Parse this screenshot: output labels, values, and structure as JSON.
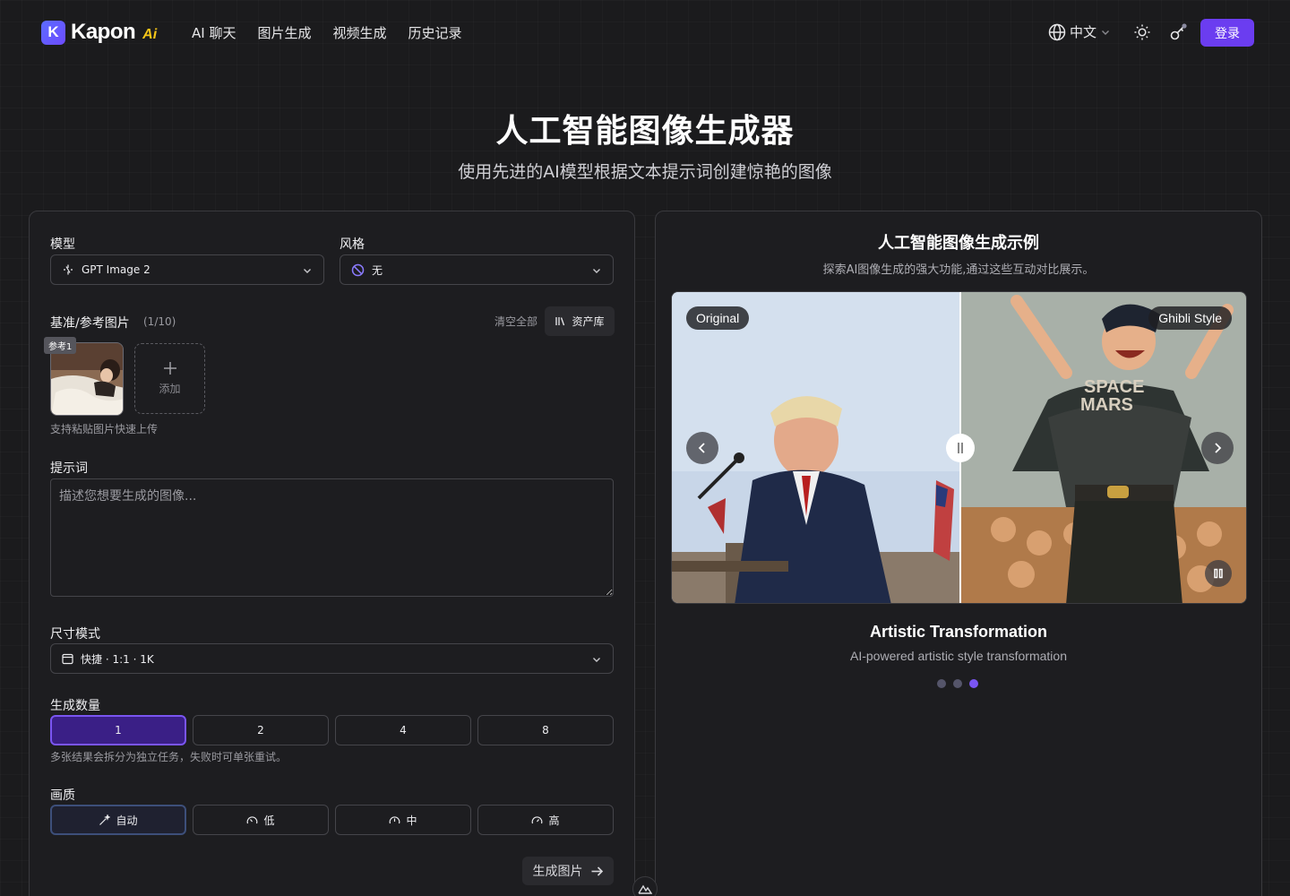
{
  "header": {
    "logo_mark": "K",
    "logo_text": "Kapon",
    "logo_ai": "Ai",
    "nav": [
      "AI 聊天",
      "图片生成",
      "视频生成",
      "历史记录"
    ],
    "language": "中文",
    "login": "登录"
  },
  "hero": {
    "title": "人工智能图像生成器",
    "subtitle": "使用先进的AI模型根据文本提示词创建惊艳的图像"
  },
  "form": {
    "model_label": "模型",
    "model_value": "GPT Image 2",
    "style_label": "风格",
    "style_value": "无",
    "reference_label": "基准/参考图片",
    "reference_count": "(1/10)",
    "clear_all": "清空全部",
    "asset_library": "资产库",
    "thumb_tag": "参考1",
    "add_label": "添加",
    "paste_hint": "支持粘贴图片快速上传",
    "prompt_label": "提示词",
    "prompt_placeholder": "描述您想要生成的图像...",
    "size_label": "尺寸模式",
    "size_value": "快捷 · 1:1 · 1K",
    "count_label": "生成数量",
    "count_options": [
      "1",
      "2",
      "4",
      "8"
    ],
    "count_selected": "1",
    "count_hint": "多张结果会拆分为独立任务，失败时可单张重试。",
    "quality_label": "画质",
    "quality_options": [
      "自动",
      "低",
      "中",
      "高"
    ],
    "quality_selected": "自动",
    "generate_button": "生成图片"
  },
  "showcase": {
    "title": "人工智能图像生成示例",
    "subtitle": "探索AI图像生成的强大功能,通过这些互动对比展示。",
    "left_label": "Original",
    "right_label": "Ghibli Style",
    "shirt_text_1": "SPACE",
    "shirt_text_2": "MARS",
    "caption_title": "Artistic Transformation",
    "caption_sub": "AI-powered artistic style transformation",
    "slides": 3,
    "active_slide": 3
  },
  "colors": {
    "accent": "#6b3df0",
    "background": "#1b1b1d",
    "panel_border": "#3a3a3e"
  }
}
